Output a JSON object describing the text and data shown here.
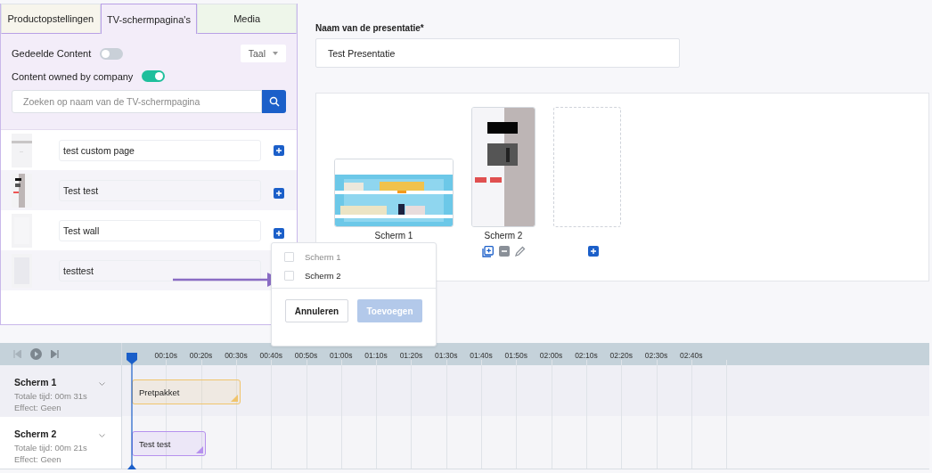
{
  "tabs": [
    {
      "label": "Productopstellingen",
      "selected": false,
      "color": "#f7f5ec"
    },
    {
      "label": "TV-schermpagina's",
      "selected": true,
      "color": "#f3edf9"
    },
    {
      "label": "Media",
      "selected": false,
      "color": "#eef6ea"
    }
  ],
  "filters": {
    "shared": {
      "label": "Gedeelde Content",
      "on": false
    },
    "owned": {
      "label": "Content owned by company",
      "on": true
    },
    "language_button": "Taal",
    "search": {
      "placeholder": "Zoeken op naam van de TV-schermpagina"
    }
  },
  "pages": [
    {
      "name": "test custom page",
      "add_button": true
    },
    {
      "name": "Test test",
      "add_button": true
    },
    {
      "name": "Test wall",
      "add_button": true
    },
    {
      "name": "testtest",
      "add_button": false
    }
  ],
  "presentation": {
    "name_label": "Naam van de presentatie*",
    "name_value": "Test Presentatie"
  },
  "screens": [
    {
      "kind": "landscape",
      "label": "Scherm 1",
      "actions": false
    },
    {
      "kind": "portrait",
      "label": "Scherm 2",
      "actions": true
    },
    {
      "kind": "empty",
      "actions": true
    }
  ],
  "popup": {
    "options": [
      {
        "label": "Scherm 1",
        "checked": false,
        "disabled": true
      },
      {
        "label": "Scherm 2",
        "checked": false,
        "disabled": false
      }
    ],
    "cancel": "Annuleren",
    "confirm": {
      "label": "Toevoegen",
      "disabled": true
    }
  },
  "timeline": {
    "ticks": [
      "00:10s",
      "00:20s",
      "00:30s",
      "00:40s",
      "00:50s",
      "01:00s",
      "01:10s",
      "01:20s",
      "01:30s",
      "01:40s",
      "01:50s",
      "02:00s",
      "02:10s",
      "02:20s",
      "02:30s",
      "02:40s"
    ],
    "tracks": [
      {
        "name": "Scherm 1",
        "total": "Totale tijd: 00m 31s",
        "effect": "Effect: Geen",
        "clip": {
          "label": "Pretpakket",
          "color": "#f0c46c"
        }
      },
      {
        "name": "Scherm 2",
        "total": "Totale tijd: 00m 21s",
        "effect": "Effect: Geen",
        "clip": {
          "label": "Test test",
          "color": "#b691ee"
        }
      }
    ]
  }
}
